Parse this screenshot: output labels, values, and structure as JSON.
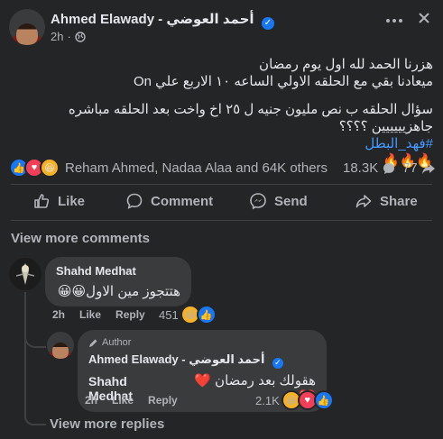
{
  "post": {
    "author_name": "أحمد العوضي - Ahmed Elawady",
    "time": "2h",
    "lines": [
      "هزرنا الحمد لله اول يوم رمضان",
      "ميعادنا بقي مع الحلقه الاولي الساعه ١٠ الاربع علي On",
      "سؤال الحلقه ب نص مليون جنيه  ل ٢٥ اخ واخت بعد الحلقه مباشره",
      "جاهزيييييين ؟؟؟؟"
    ],
    "hashtag": "#فهد_البطل",
    "fire": "🔥🔥🔥"
  },
  "reactions": {
    "summary": "Reham Ahmed, Nadaa Alaa and 64K others",
    "comments_count": "18.3K",
    "shares_count": "77"
  },
  "actions": {
    "like": "Like",
    "comment": "Comment",
    "send": "Send",
    "share": "Share"
  },
  "view_more_comments": "View more comments",
  "comment1": {
    "name": "Shahd Medhat",
    "text": "هتتجوز مين الاول😀😀",
    "time": "2h",
    "like": "Like",
    "reply": "Reply",
    "reactions": "451"
  },
  "reply1": {
    "badge": "Author",
    "name": "Ahmed Elawady - أحمد العوضي",
    "mention": "Shahd Medhat",
    "text": "هقولك بعد رمضان ❤️❤️",
    "time": "2h",
    "like": "Like",
    "reply": "Reply",
    "reactions": "2.1K"
  },
  "view_more_replies": "View more replies",
  "colors": {
    "background": "#242526",
    "bubble": "#3a3b3c",
    "link": "#4599ff",
    "verified": "#1877f2"
  }
}
